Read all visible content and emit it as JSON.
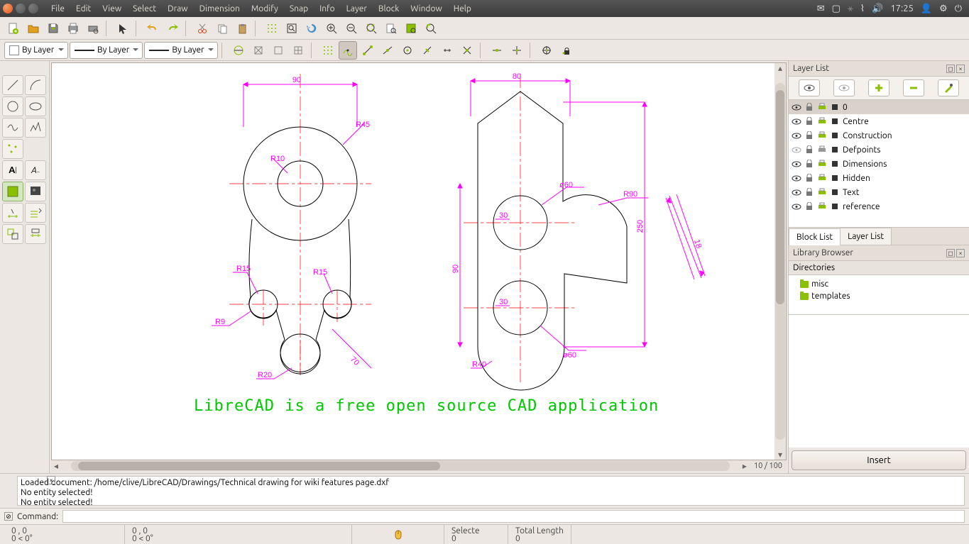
{
  "menu": [
    "File",
    "Edit",
    "View",
    "Select",
    "Draw",
    "Dimension",
    "Modify",
    "Snap",
    "Info",
    "Layer",
    "Block",
    "Window",
    "Help"
  ],
  "systray": {
    "time": "17:25"
  },
  "layer_combo": "By Layer",
  "zoom": "10 / 100",
  "right": {
    "layerlist_title": "Layer List",
    "layers": [
      "0",
      "Centre",
      "Construction",
      "Defpoints",
      "Dimensions",
      "Hidden",
      "Text",
      "reference"
    ],
    "tabs": [
      "Block List",
      "Layer List"
    ],
    "library_title": "Library Browser",
    "dirs_header": "Directories",
    "dirs": [
      "misc",
      "templates"
    ],
    "insert": "Insert"
  },
  "console": {
    "lines": [
      "Loaded document: /home/clive/LibreCAD/Drawings/Technical drawing for wiki features page.dxf",
      "No entity selected!",
      "No entity selected!"
    ],
    "cmd_label": "Command:"
  },
  "status": {
    "abs": "0 , 0",
    "pol": "0 < 0°",
    "rel_abs": "0 , 0",
    "rel_pol": "0 < 0°",
    "selected": "Selecte",
    "total": "Total Length",
    "zero": "0"
  },
  "drawing": {
    "dims_left": {
      "top": "90",
      "r45": "R45",
      "r10": "R10",
      "r15a": "R15",
      "r15b": "R15",
      "r9": "R9",
      "r20": "R20",
      "d70": "70"
    },
    "dims_right": {
      "top": "80",
      "d60a": "ø60",
      "r90": "R90",
      "d30a": "30",
      "v90": "90",
      "d30b": "30",
      "d60b": "ø60",
      "r40": "R40",
      "v250": "250",
      "d18": "18"
    },
    "caption": "LibreCAD is a free open source CAD application"
  }
}
